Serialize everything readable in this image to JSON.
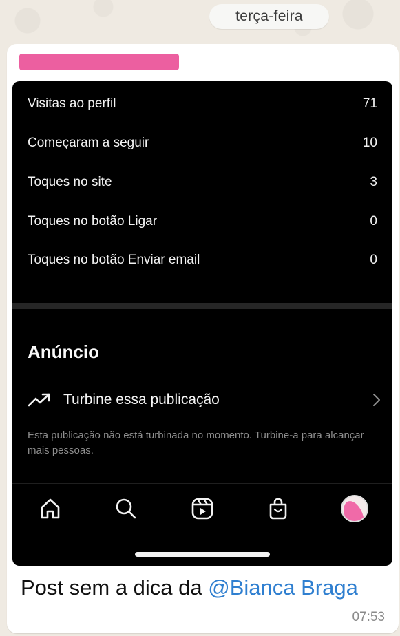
{
  "date_separator": "terça-feira",
  "message": {
    "sender_redacted": "",
    "caption_text": "Post sem a dica da ",
    "mention_at": "@",
    "mention_name": "Bianca Braga",
    "time": "07:53"
  },
  "insights": {
    "stats": [
      {
        "label": "Visitas ao perfil",
        "value": "71"
      },
      {
        "label": "Começaram a seguir",
        "value": "10"
      },
      {
        "label": "Toques no site",
        "value": "3"
      },
      {
        "label": "Toques no botão Ligar",
        "value": "0"
      },
      {
        "label": "Toques no botão Enviar email",
        "value": "0"
      }
    ],
    "ad_section_title": "Anúncio",
    "boost_label": "Turbine essa publicação",
    "boost_note": "Esta publicação não está turbinada no momento. Turbine-a para alcançar mais pessoas."
  },
  "nav": {
    "icons": [
      "home-icon",
      "search-icon",
      "reels-icon",
      "shop-icon",
      "profile-avatar"
    ]
  },
  "colors": {
    "chat_background": "#efeae2",
    "bubble": "#ffffff",
    "screenshot_bg": "#000000",
    "mention": "#2f7fd0",
    "redaction": "#ec5fa0"
  }
}
